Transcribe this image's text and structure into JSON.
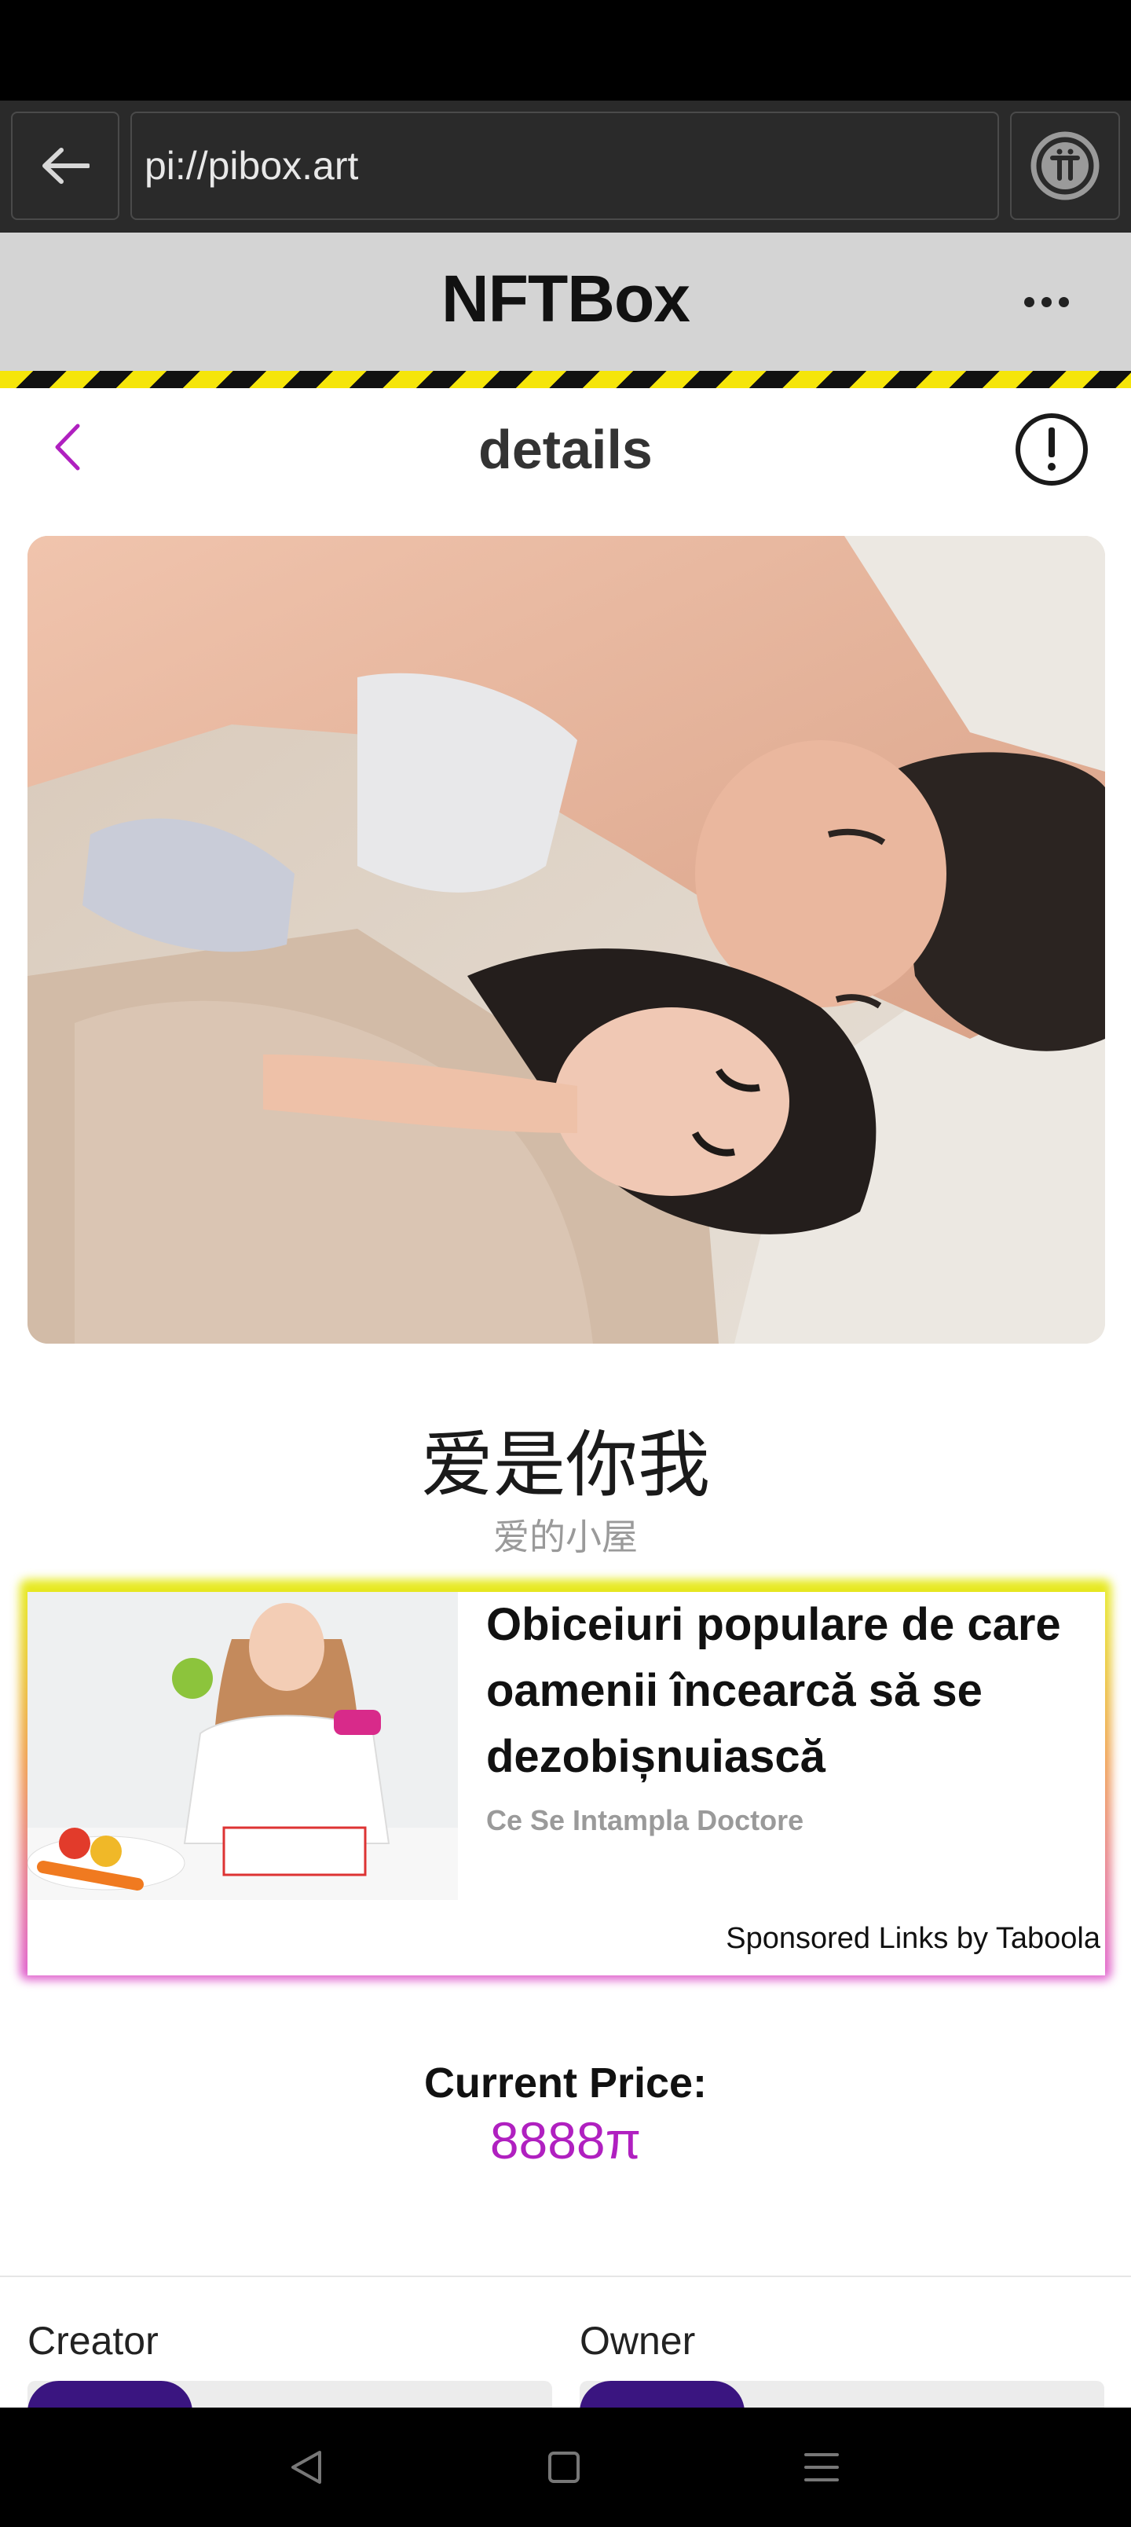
{
  "browser": {
    "url": "pi://pibox.art"
  },
  "app": {
    "title": "NFTBox"
  },
  "nav": {
    "title": "details"
  },
  "nft": {
    "title": "爱是你我",
    "collection": "爱的小屋"
  },
  "ad": {
    "headline": "Obiceiuri populare de care oamenii încearcă să se dezobișnuiască",
    "source": "Ce Se Intampla Doctore",
    "sponsor": "Sponsored Links by Taboola"
  },
  "price": {
    "label": "Current Price:",
    "value": "8888π"
  },
  "people": {
    "creator_label": "Creator",
    "owner_label": "Owner"
  },
  "colors": {
    "accent": "#b020c0",
    "header_bg": "#d4d4d4",
    "stripe_yellow": "#f5e50a"
  },
  "icons": [
    "back-arrow-icon",
    "pi-logo-icon",
    "more-dots-icon",
    "chevron-left-icon",
    "info-icon",
    "nav-back-icon",
    "nav-home-icon",
    "nav-menu-icon"
  ]
}
